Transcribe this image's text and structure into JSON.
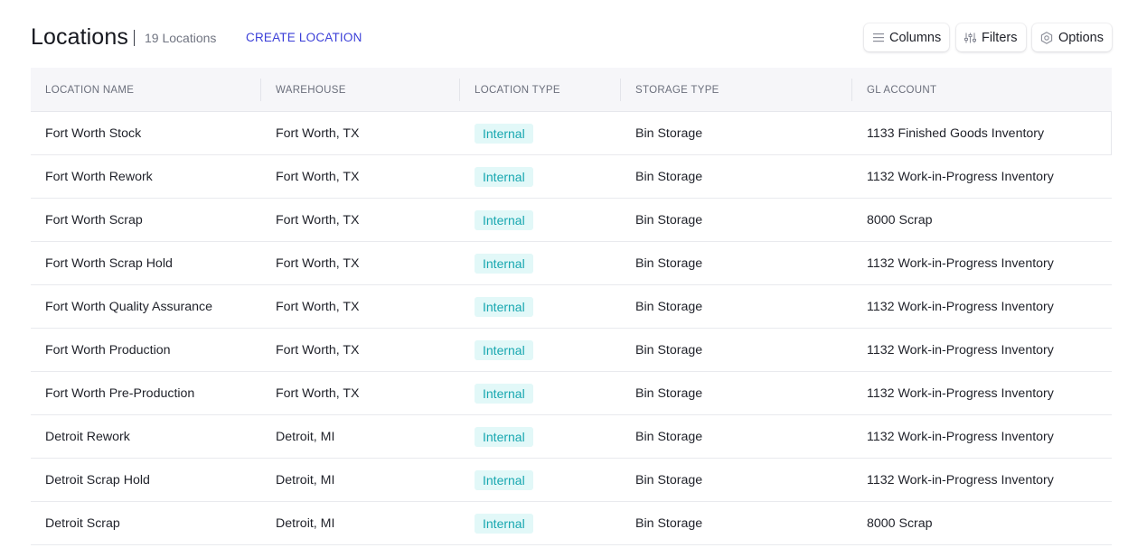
{
  "header": {
    "title": "Locations",
    "count": "19 Locations",
    "create_label": "CREATE LOCATION"
  },
  "toolbar": {
    "columns_label": "Columns",
    "columns_icon": "menu-lines-icon",
    "filters_label": "Filters",
    "filters_icon": "sliders-icon",
    "options_label": "Options",
    "options_icon": "hexagon-settings-icon"
  },
  "table": {
    "columns": [
      "LOCATION NAME",
      "WAREHOUSE",
      "LOCATION TYPE",
      "STORAGE TYPE",
      "GL ACCOUNT"
    ],
    "rows": [
      {
        "name": "Fort Worth Stock",
        "warehouse": "Fort Worth, TX",
        "type": "Internal",
        "storage": "Bin Storage",
        "gl": "1133 Finished Goods Inventory"
      },
      {
        "name": "Fort Worth Rework",
        "warehouse": "Fort Worth, TX",
        "type": "Internal",
        "storage": "Bin Storage",
        "gl": "1132 Work-in-Progress Inventory"
      },
      {
        "name": "Fort Worth Scrap",
        "warehouse": "Fort Worth, TX",
        "type": "Internal",
        "storage": "Bin Storage",
        "gl": "8000 Scrap"
      },
      {
        "name": "Fort Worth Scrap Hold",
        "warehouse": "Fort Worth, TX",
        "type": "Internal",
        "storage": "Bin Storage",
        "gl": "1132 Work-in-Progress Inventory"
      },
      {
        "name": "Fort Worth Quality Assurance",
        "warehouse": "Fort Worth, TX",
        "type": "Internal",
        "storage": "Bin Storage",
        "gl": "1132 Work-in-Progress Inventory"
      },
      {
        "name": "Fort Worth Production",
        "warehouse": "Fort Worth, TX",
        "type": "Internal",
        "storage": "Bin Storage",
        "gl": "1132 Work-in-Progress Inventory"
      },
      {
        "name": "Fort Worth Pre-Production",
        "warehouse": "Fort Worth, TX",
        "type": "Internal",
        "storage": "Bin Storage",
        "gl": "1132 Work-in-Progress Inventory"
      },
      {
        "name": "Detroit Rework",
        "warehouse": "Detroit, MI",
        "type": "Internal",
        "storage": "Bin Storage",
        "gl": "1132 Work-in-Progress Inventory"
      },
      {
        "name": "Detroit Scrap Hold",
        "warehouse": "Detroit, MI",
        "type": "Internal",
        "storage": "Bin Storage",
        "gl": "1132 Work-in-Progress Inventory"
      },
      {
        "name": "Detroit Scrap",
        "warehouse": "Detroit, MI",
        "type": "Internal",
        "storage": "Bin Storage",
        "gl": "8000 Scrap"
      }
    ]
  },
  "colors": {
    "accent": "#3b3fd8",
    "badge_bg": "#e2f8f8",
    "badge_text": "#17a7b0"
  }
}
